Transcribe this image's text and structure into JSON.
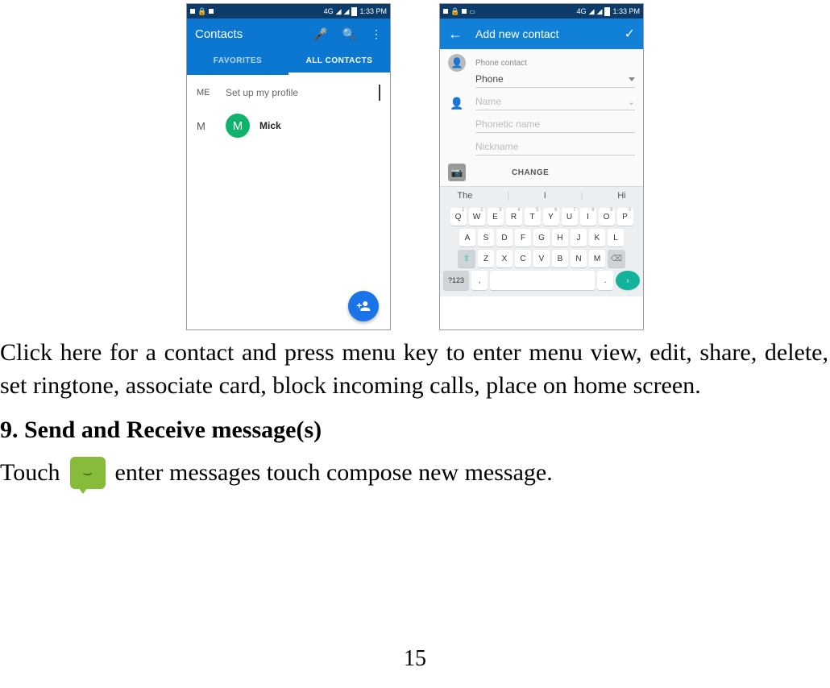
{
  "status_bar": {
    "time": "1:33 PM",
    "network": "4G"
  },
  "left_phone": {
    "title": "Contacts",
    "tabs": {
      "favorites": "FAVORITES",
      "all": "ALL CONTACTS"
    },
    "me_label": "ME",
    "me_text": "Set up my profile",
    "letter": "M",
    "contact_initial": "M",
    "contact_name": "Mick"
  },
  "right_phone": {
    "title": "Add new contact",
    "account_label": "Phone contact",
    "account_value": "Phone",
    "name_placeholder": "Name",
    "phonetic_placeholder": "Phonetic name",
    "nickname_placeholder": "Nickname",
    "change_label": "CHANGE",
    "suggestions": [
      "The",
      "I",
      "Hi"
    ],
    "row1": [
      {
        "n": "1",
        "l": "Q"
      },
      {
        "n": "2",
        "l": "W"
      },
      {
        "n": "3",
        "l": "E"
      },
      {
        "n": "4",
        "l": "R"
      },
      {
        "n": "5",
        "l": "T"
      },
      {
        "n": "6",
        "l": "Y"
      },
      {
        "n": "7",
        "l": "U"
      },
      {
        "n": "8",
        "l": "I"
      },
      {
        "n": "9",
        "l": "O"
      },
      {
        "n": "0",
        "l": "P"
      }
    ],
    "row2": [
      "A",
      "S",
      "D",
      "F",
      "G",
      "H",
      "J",
      "K",
      "L"
    ],
    "row3": [
      "Z",
      "X",
      "C",
      "V",
      "B",
      "N",
      "M"
    ],
    "sym_label": "?123"
  },
  "body_text": {
    "p1": "Click here for a contact and press menu key to enter menu view, edit, share, delete, set ringtone, associate card, block incoming calls, place on home screen.",
    "h1": "9. Send and Receive message(s)",
    "touch_label": "Touch",
    "p2_rest": "enter messages touch compose new message."
  },
  "page_number": "15"
}
